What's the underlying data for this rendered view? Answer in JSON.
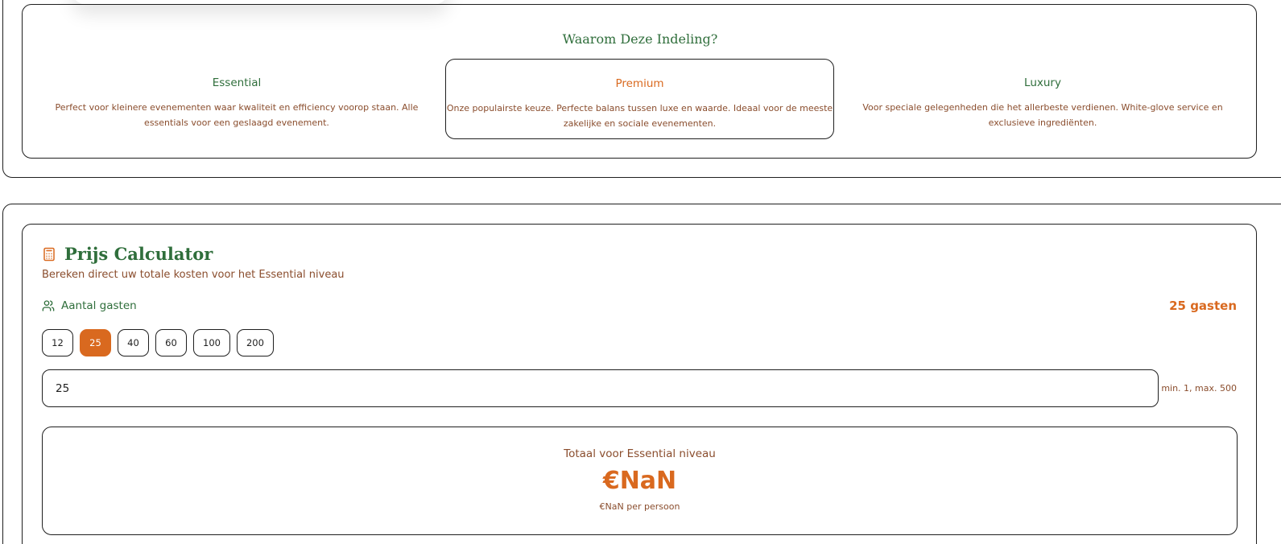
{
  "why": {
    "title": "Waarom Deze Indeling?",
    "tiers": [
      {
        "name": "Essential",
        "description": "Perfect voor kleinere evenementen waar kwaliteit en efficiency voorop staan. Alle essentials voor een geslaagd evenement."
      },
      {
        "name": "Premium",
        "description": "Onze populairste keuze. Perfecte balans tussen luxe en waarde. Ideaal voor de meeste zakelijke en sociale evenementen."
      },
      {
        "name": "Luxury",
        "description": "Voor speciale gelegenheden die het allerbeste verdienen. White-glove service en exclusieve ingrediënten."
      }
    ]
  },
  "calculator": {
    "icon": "calculator-icon",
    "title": "Prijs Calculator",
    "subtitle": "Bereken direct uw totale kosten voor het Essential niveau",
    "guests_label": "Aantal gasten",
    "guests_icon": "users-icon",
    "guests_count": "25 gasten",
    "presets": [
      "12",
      "25",
      "40",
      "60",
      "100",
      "200"
    ],
    "active_preset": "25",
    "input_value": "25",
    "minmax": "min. 1, max. 500",
    "total_label": "Totaal voor Essential niveau",
    "total_value": "€NaN",
    "per_person": "€NaN per persoon"
  },
  "colors": {
    "green": "#2f6e3b",
    "orange": "#d9691f",
    "brown": "#8a4d2d",
    "border": "#1f1f1f"
  }
}
